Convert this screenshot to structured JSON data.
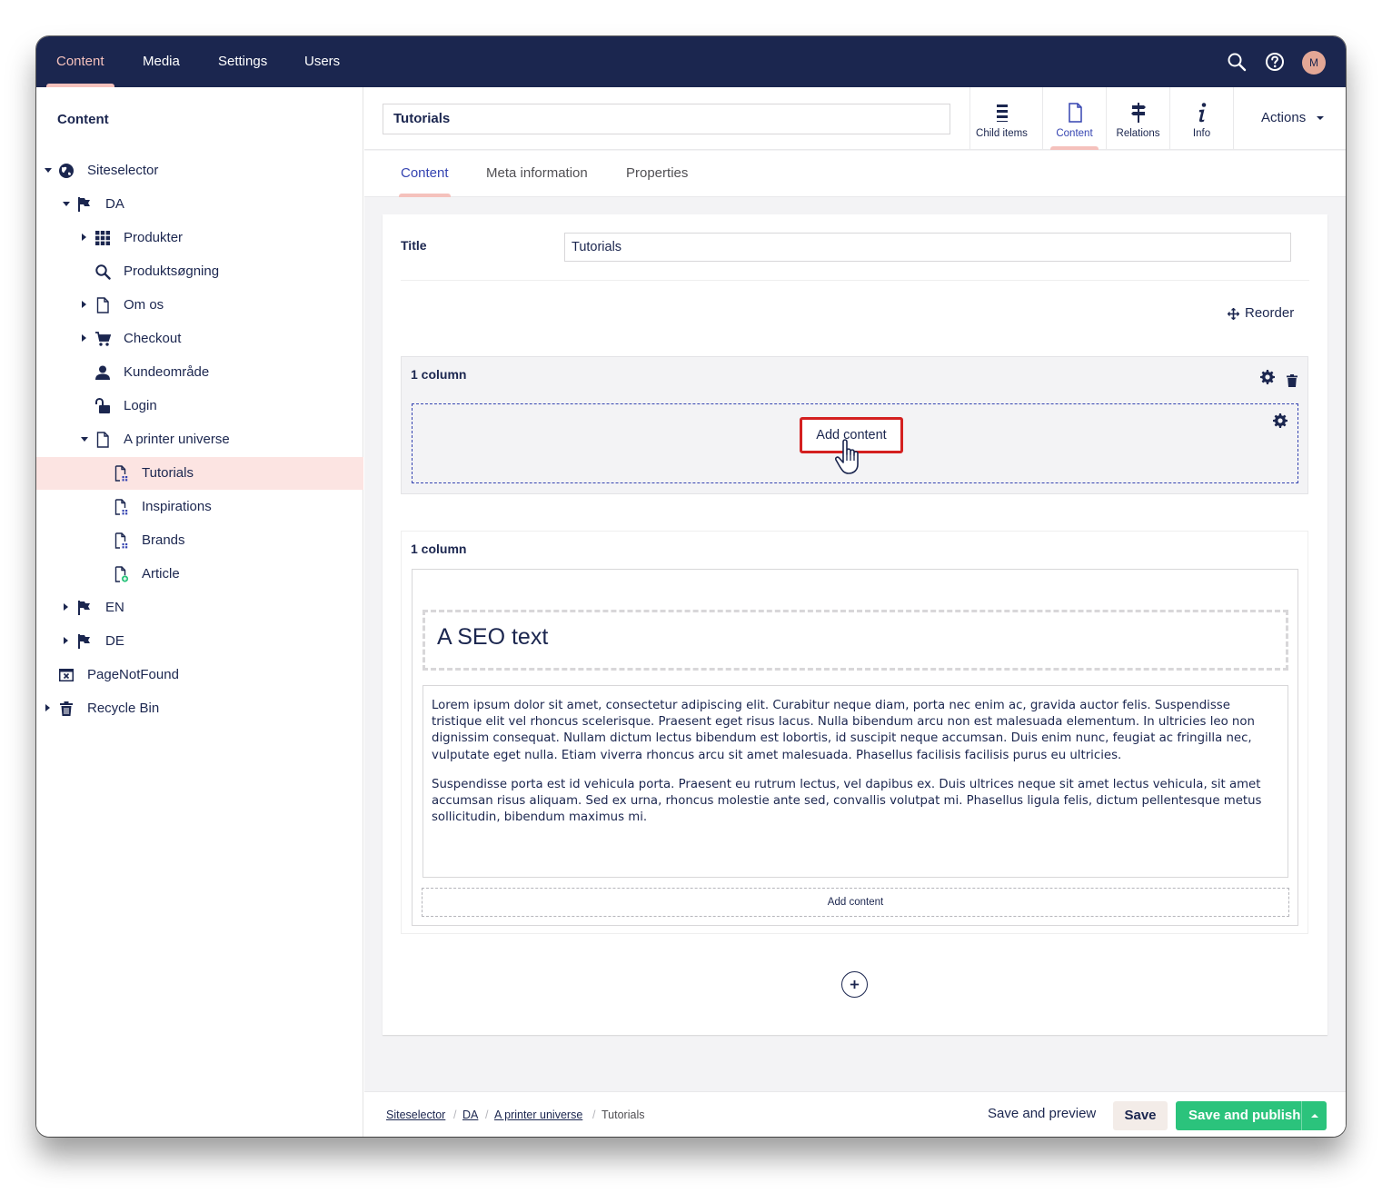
{
  "topnav": {
    "sections": [
      "Content",
      "Media",
      "Settings",
      "Users"
    ],
    "active": "Content",
    "icons": [
      "search-icon",
      "help-icon"
    ],
    "user_initial": "M"
  },
  "sidebar": {
    "title": "Content",
    "tree": [
      {
        "label": "Siteselector",
        "icon": "globe-icon"
      },
      {
        "label": "DA",
        "icon": "flag-icon"
      },
      {
        "label": "Produkter",
        "icon": "grid-icon"
      },
      {
        "label": "Produktsøgning",
        "icon": "search-icon"
      },
      {
        "label": "Om os",
        "icon": "document-icon"
      },
      {
        "label": "Checkout",
        "icon": "cart-icon"
      },
      {
        "label": "Kundeområde",
        "icon": "user-icon"
      },
      {
        "label": "Login",
        "icon": "unlock-icon"
      },
      {
        "label": "A printer universe",
        "icon": "document-icon"
      },
      {
        "label": "Tutorials",
        "icon": "document-list-icon"
      },
      {
        "label": "Inspirations",
        "icon": "document-list-icon"
      },
      {
        "label": "Brands",
        "icon": "document-list-icon"
      },
      {
        "label": "Article",
        "icon": "document-add-icon"
      },
      {
        "label": "EN",
        "icon": "flag-icon"
      },
      {
        "label": "DE",
        "icon": "flag-icon"
      },
      {
        "label": "PageNotFound",
        "icon": "browser-window-icon"
      },
      {
        "label": "Recycle Bin",
        "icon": "trash-icon"
      }
    ],
    "selected": "Tutorials"
  },
  "header": {
    "name": "Tutorials",
    "apps": [
      {
        "label": "Child items",
        "icon": "list-icon"
      },
      {
        "label": "Content",
        "icon": "document-icon"
      },
      {
        "label": "Relations",
        "icon": "signpost-icon"
      },
      {
        "label": "Info",
        "icon": "info-icon"
      }
    ],
    "active_app": "Content",
    "actions_label": "Actions"
  },
  "tabs": {
    "items": [
      "Content",
      "Meta information",
      "Properties"
    ],
    "active": "Content"
  },
  "editor": {
    "title_label": "Title",
    "title_value": "Tutorials",
    "reorder_label": "Reorder",
    "sections": [
      {
        "title": "1 column",
        "add_content_label": "Add content"
      },
      {
        "title": "1 column",
        "headline": "A SEO text",
        "paragraphs": [
          "Lorem ipsum dolor sit amet, consectetur adipiscing elit. Curabitur neque diam, porta nec enim ac, gravida auctor felis. Suspendisse tristique elit vel rhoncus scelerisque. Praesent eget risus lacus. Nulla bibendum arcu non est malesuada elementum. In ultricies leo non dignissim consequat. Nullam dictum lectus bibendum est lobortis, id suscipit neque accumsan. Duis enim nunc, feugiat ac fringilla nec, vulputate eget nulla. Etiam viverra rhoncus arcu sit amet malesuada. Phasellus facilisis facilisis purus eu ultricies.",
          "Suspendisse porta est id vehicula porta. Praesent eu rutrum lectus, vel dapibus ex. Duis ultrices neque sit amet lectus vehicula, sit amet accumsan risus aliquam. Sed ex urna, rhoncus molestie ante sed, convallis volutpat mi. Phasellus ligula felis, dictum pellentesque metus sollicitudin, bibendum maximus mi."
        ],
        "add_content_label": "Add content"
      }
    ]
  },
  "footer": {
    "breadcrumb": [
      "Siteselector",
      "DA",
      "A printer universe",
      "Tutorials"
    ],
    "save_preview_label": "Save and preview",
    "save_label": "Save",
    "save_publish_label": "Save and publish"
  },
  "colors": {
    "nav_bg": "#1b264f",
    "accent": "#f5c1bc",
    "active_text": "#3544b1",
    "selected_row": "#fce4e2",
    "publish": "#2bc37c",
    "highlight": "#d42020"
  }
}
